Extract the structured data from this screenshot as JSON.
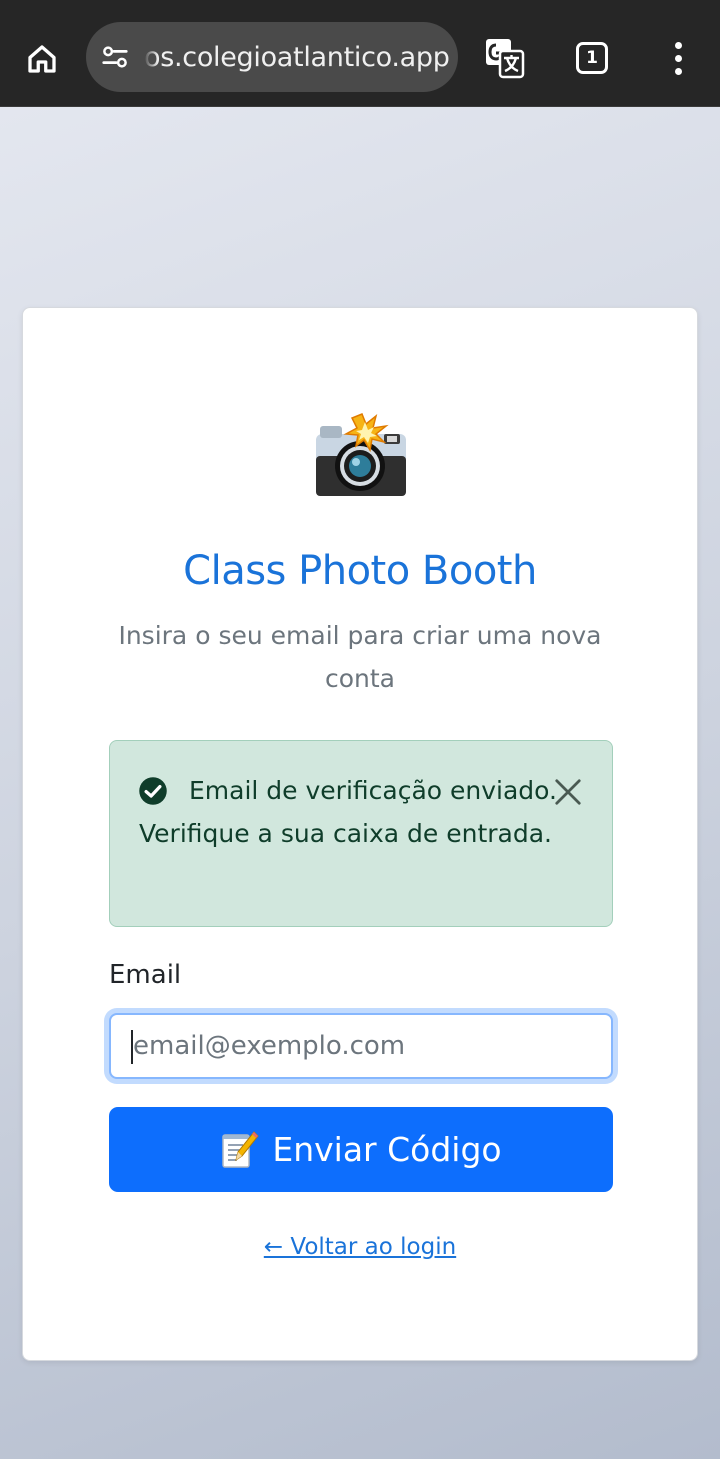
{
  "browser": {
    "url": "os.colegioatlantico.app",
    "tab_count": "1",
    "icons": {
      "home": "home-icon",
      "site_info": "tune-icon",
      "translate": "translate-icon",
      "menu": "more-vert-icon"
    }
  },
  "card": {
    "logo_icon": "camera-flash-icon",
    "title": "Class Photo Booth",
    "subtitle": "Insira o seu email para criar uma nova conta",
    "alert": {
      "message": "Email de verificação enviado. Verifique a sua caixa de entrada.",
      "type": "success"
    },
    "email": {
      "label": "Email",
      "placeholder": "email@exemplo.com",
      "value": ""
    },
    "submit_label": "Enviar Código",
    "submit_icon": "memo-icon",
    "back_link": "← Voltar ao login"
  },
  "colors": {
    "accent": "#0d6efd",
    "title": "#1a73d9",
    "alert_bg": "#d1e7dd",
    "alert_text": "#0f3d2a"
  }
}
